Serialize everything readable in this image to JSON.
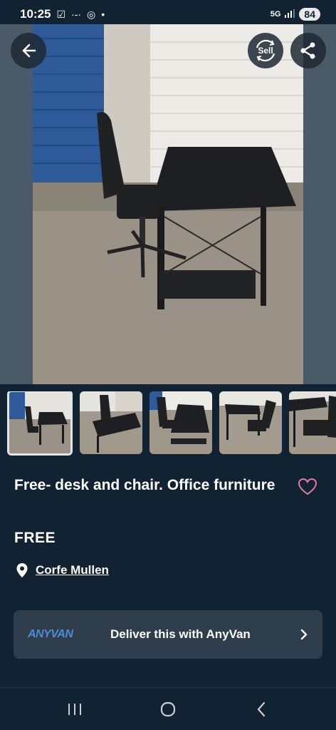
{
  "status_bar": {
    "time": "10:25",
    "network": "5G",
    "battery": "84"
  },
  "hero": {
    "sell_label": "Sell"
  },
  "thumbnails": {
    "count": 5,
    "active_index": 0
  },
  "listing": {
    "title": "Free- desk and chair. Office furniture",
    "price": "FREE",
    "location": "Corfe Mullen"
  },
  "anyvan": {
    "logo": "ANYVAN",
    "text": "Deliver this with AnyVan"
  },
  "icons": {
    "back": "arrow-left-icon",
    "sell": "sell-icon",
    "share": "share-icon",
    "favorite": "heart-outline-icon",
    "location": "location-pin-icon",
    "chevron": "chevron-right-icon"
  },
  "colors": {
    "background": "#112233",
    "card": "#2f3e4c",
    "heart": "#e07aa6",
    "anyvan_logo": "#4a8cd8"
  }
}
